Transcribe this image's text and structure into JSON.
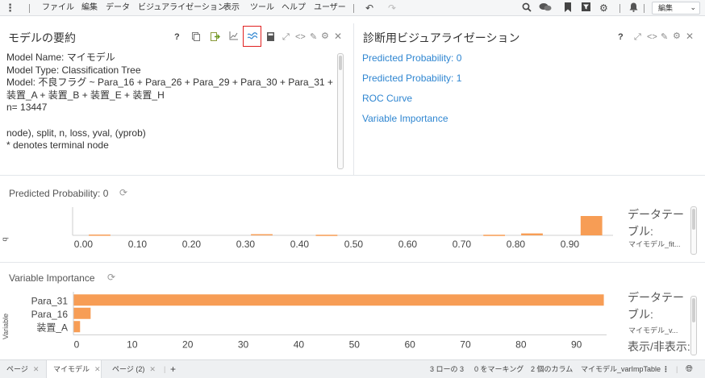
{
  "menubar": {
    "items": [
      "ファイル",
      "編集",
      "データ",
      "ビジュアライゼーション",
      "表示",
      "ツール",
      "ヘルプ",
      "ユーザー"
    ],
    "edit_select": "編集"
  },
  "summary_panel": {
    "title": "モデルの要約",
    "lines": [
      "Model Name: マイモデル",
      "Model Type: Classification Tree",
      "Model: 不良フラグ ~ Para_16 + Para_26 + Para_29 + Para_30 + Para_31 +",
      "装置_A + 装置_B + 装置_E + 装置_H",
      "n= 13447",
      "",
      "node), split, n, loss, yval, (yprob)",
      "* denotes terminal node"
    ]
  },
  "diag_panel": {
    "title": "診断用ビジュアライゼーション",
    "links": [
      "Predicted Probability: 0",
      "Predicted Probability: 1",
      "ROC Curve",
      "Variable Importance"
    ]
  },
  "colors": {
    "bar": "#f79d55",
    "link": "#2f86d1",
    "highlight": "#e02020"
  },
  "pp_chart": {
    "title": "Predicted Probability: 0",
    "side_title": "データテーブル:",
    "side_sub": "マイモデル_fit...",
    "y_axis_letter": "q",
    "chart_data": {
      "type": "bar",
      "xlim": [
        -0.02,
        0.98
      ],
      "ylim": [
        0,
        1
      ],
      "bins": [
        {
          "x0": 0.01,
          "x1": 0.05,
          "v": 0.04
        },
        {
          "x0": 0.31,
          "x1": 0.35,
          "v": 0.06
        },
        {
          "x0": 0.43,
          "x1": 0.47,
          "v": 0.03
        },
        {
          "x0": 0.74,
          "x1": 0.78,
          "v": 0.03
        },
        {
          "x0": 0.81,
          "x1": 0.85,
          "v": 0.1
        },
        {
          "x0": 0.92,
          "x1": 0.96,
          "v": 1.0
        }
      ],
      "ticks": [
        "0.00",
        "0.10",
        "0.20",
        "0.30",
        "0.40",
        "0.50",
        "0.60",
        "0.70",
        "0.80",
        "0.90"
      ],
      "tick_values": [
        0.0,
        0.1,
        0.2,
        0.3,
        0.4,
        0.5,
        0.6,
        0.7,
        0.8,
        0.9
      ]
    }
  },
  "vi_chart": {
    "title": "Variable Importance",
    "side_title": "データテーブル:",
    "side_sub": "マイモデル_v...",
    "side_toggle": "表示/非表示:",
    "ylabel": "Variable",
    "chart_data": {
      "type": "bar",
      "orientation": "horizontal",
      "categories": [
        "Para_31",
        "Para_16",
        "装置_A"
      ],
      "values": [
        95.5,
        3.1,
        1.2
      ],
      "xlim": [
        0,
        96
      ],
      "ticks": [
        "0",
        "10",
        "20",
        "30",
        "40",
        "50",
        "60",
        "70",
        "80",
        "90"
      ],
      "tick_values": [
        0,
        10,
        20,
        30,
        40,
        50,
        60,
        70,
        80,
        90
      ]
    }
  },
  "statusbar": {
    "tabs": [
      {
        "label": "ページ",
        "active": false
      },
      {
        "label": "マイモデル",
        "active": true
      },
      {
        "label": "ページ (2)",
        "active": false
      }
    ],
    "add": "+",
    "stats": [
      "3 ローの 3",
      "0 をマーキング",
      "2 個のカラム",
      "マイモデル_varImpTable"
    ]
  }
}
